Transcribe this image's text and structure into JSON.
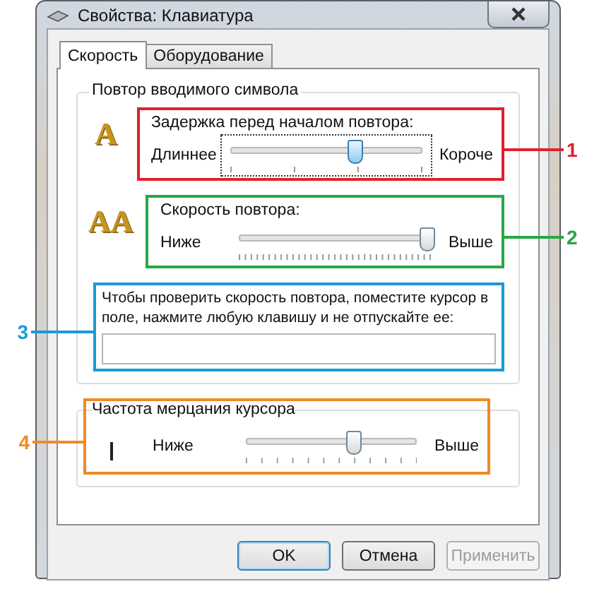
{
  "window": {
    "title": "Свойства: Клавиатура"
  },
  "tabs": [
    {
      "label": "Скорость",
      "selected": true
    },
    {
      "label": "Оборудование",
      "selected": false
    }
  ],
  "repeat_group": {
    "title": "Повтор вводимого символа",
    "delay": {
      "icon_text": "A",
      "label": "Задержка перед началом повтора:",
      "min_label": "Длиннее",
      "max_label": "Короче",
      "level": 0.65,
      "focused": true,
      "callout": {
        "label": "1",
        "color": "#e0202c",
        "kind": "right"
      }
    },
    "rate": {
      "icon_text": "AA",
      "label": "Скорость повтора:",
      "min_label": "Ниже",
      "max_label": "Выше",
      "level": 0.98,
      "focused": false,
      "callout": {
        "label": "2",
        "color": "#27a844",
        "kind": "right"
      }
    },
    "test": {
      "label": "Чтобы проверить скорость повтора, поместите курсор в поле, нажмите любую клавишу и не отпускайте ее:",
      "callout": {
        "label": "3",
        "color": "#1a9ad6",
        "kind": "left"
      }
    }
  },
  "blink_group": {
    "title": "Частота мерцания курсора",
    "min_label": "Ниже",
    "max_label": "Выше",
    "level": 0.63,
    "focused": false,
    "callout": {
      "label": "4",
      "color": "#f08a24",
      "kind": "left"
    }
  },
  "buttons": [
    {
      "label": "OK",
      "default": true,
      "disabled": false
    },
    {
      "label": "Отмена",
      "default": false,
      "disabled": false
    },
    {
      "label": "Применить",
      "default": false,
      "disabled": true
    }
  ]
}
